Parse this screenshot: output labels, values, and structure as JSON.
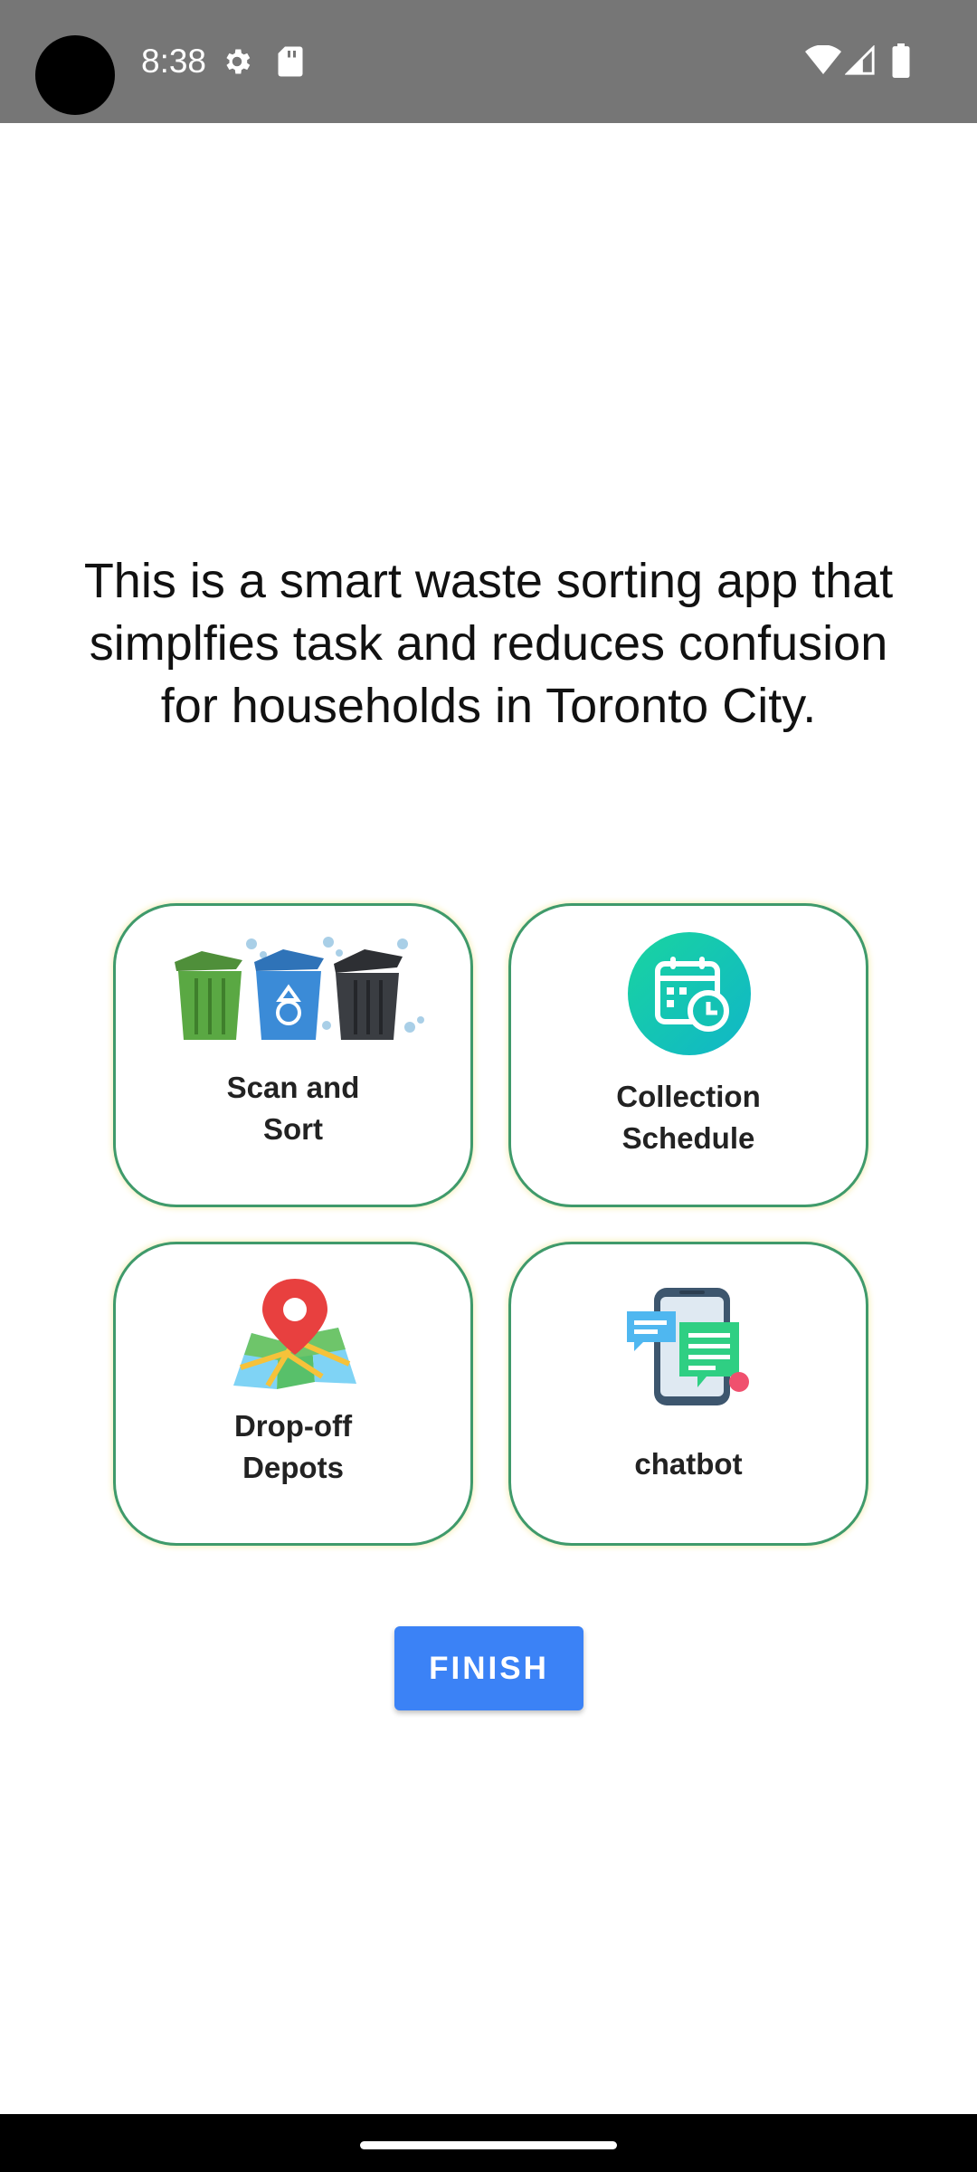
{
  "status_bar": {
    "time": "8:38",
    "icons": [
      "gear-icon",
      "sd-card-icon",
      "wifi-icon",
      "cell-signal-icon",
      "battery-icon"
    ]
  },
  "headline": "This is a smart waste sorting app that simplfies task and reduces confusion for households in Toronto City.",
  "cards": [
    {
      "label_line1": "Scan and",
      "label_line2": "Sort",
      "icon": "recycling-bins-icon"
    },
    {
      "label_line1": "Collection",
      "label_line2": "Schedule",
      "icon": "calendar-clock-icon"
    },
    {
      "label_line1": "Drop-off",
      "label_line2": "Depots",
      "icon": "map-pin-icon"
    },
    {
      "label_line1": "chatbot",
      "icon": "phone-chat-icon"
    }
  ],
  "finish_button": {
    "label": "FINISH"
  },
  "colors": {
    "status_bar": "#767676",
    "card_border": "#3f9a6b",
    "button": "#3b82f6"
  }
}
